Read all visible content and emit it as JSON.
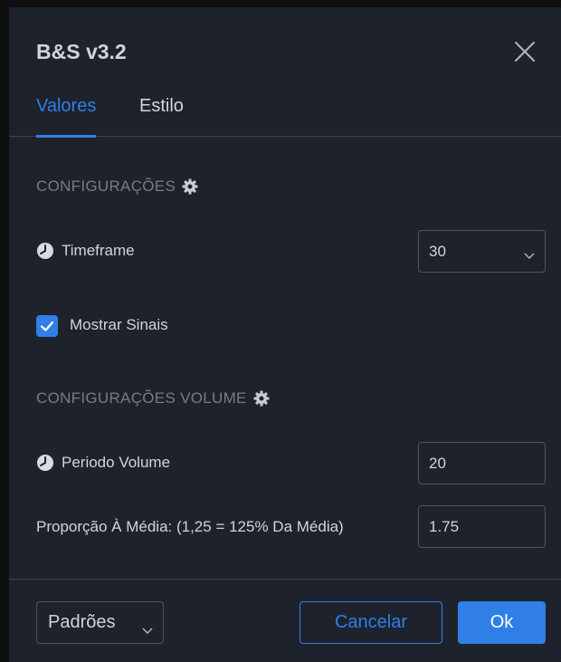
{
  "dialog": {
    "title": "B&S v3.2"
  },
  "tabs": [
    {
      "label": "Valores",
      "active": true
    },
    {
      "label": "Estilo",
      "active": false
    }
  ],
  "sections": {
    "config": {
      "title": "CONFIGURAÇÕES",
      "icon": "gear-icon"
    },
    "volume": {
      "title": "CONFIGURAÇÕES VOLUME",
      "icon": "gear-icon"
    }
  },
  "fields": {
    "timeframe": {
      "label": "Timeframe",
      "icon": "clock-icon",
      "value": "30"
    },
    "show_signals": {
      "label": "Mostrar Sinais",
      "checked": true
    },
    "volume_period": {
      "label": "Periodo Volume",
      "icon": "clock-icon",
      "value": "20"
    },
    "ratio": {
      "label": "Proporção À Média: (1,25 = 125% Da Média)",
      "value": "1.75"
    }
  },
  "footer": {
    "defaults_label": "Padrões",
    "cancel_label": "Cancelar",
    "ok_label": "Ok"
  },
  "colors": {
    "accent": "#2f7fe6",
    "background": "#1e222d",
    "text": "#d1d4dc",
    "muted": "#787b86"
  }
}
